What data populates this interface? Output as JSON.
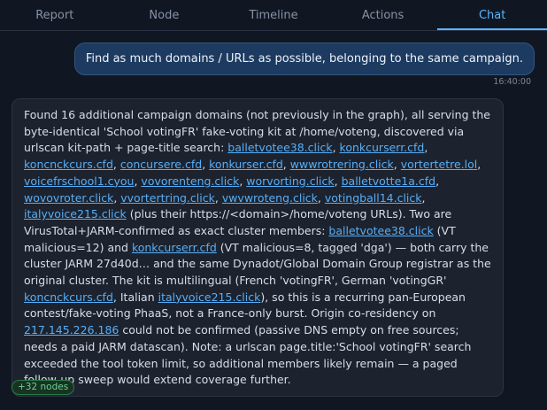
{
  "tabs": [
    {
      "label": "Report"
    },
    {
      "label": "Node"
    },
    {
      "label": "Timeline"
    },
    {
      "label": "Actions"
    },
    {
      "label": "Chat"
    }
  ],
  "user_message": {
    "text": "Find as much domains / URLs as possible, belonging to the same campaign.",
    "time": "16:40:00"
  },
  "assistant": {
    "t1": "Found 16 additional campaign domains (not previously in the graph), all serving the byte-identical 'School votingFR' fake-voting kit at /home/voteng, discovered via urlscan kit-path + page-title search: ",
    "domains": [
      "balletvotee38.click",
      "konkcurserr.cfd",
      "koncnckcurs.cfd",
      "concursere.cfd",
      "konkurser.cfd",
      "wwwrotrering.click",
      "vortertetre.lol",
      "voicefrschool1.cyou",
      "vovorenteng.click",
      "worvorting.click",
      "balletvotte1a.cfd",
      "wovovroter.click",
      "vvortertring.click",
      "vwvwroteng.click",
      "votingball14.click",
      "italyvoice215.click"
    ],
    "sep": ", ",
    "t2": " (plus their https://<domain>/home/voteng URLs). Two are VirusTotal+JARM-confirmed as exact cluster members: ",
    "m1": "balletvotee38.click",
    "t3": " (VT malicious=12) and ",
    "m2": "konkcurserr.cfd",
    "t4": " (VT malicious=8, tagged 'dga') — both carry the cluster JARM 27d40d… and the same Dynadot/Global Domain Group registrar as the original cluster. The kit is multilingual (French 'votingFR', German 'votingGR' ",
    "m3": "koncnckcurs.cfd",
    "t5": ", Italian ",
    "m4": "italyvoice215.click",
    "t6": "), so this is a recurring pan-European contest/fake-voting PhaaS, not a France-only burst. Origin co-residency on ",
    "ip": "217.145.226.186",
    "t7": " could not be confirmed (passive DNS empty on free sources; needs a paid JARM datascan). Note: a urlscan page.title:'School votingFR' search exceeded the tool token limit, so additional members likely remain — a paged follow-up sweep would extend coverage further."
  },
  "badge": "+32 nodes"
}
